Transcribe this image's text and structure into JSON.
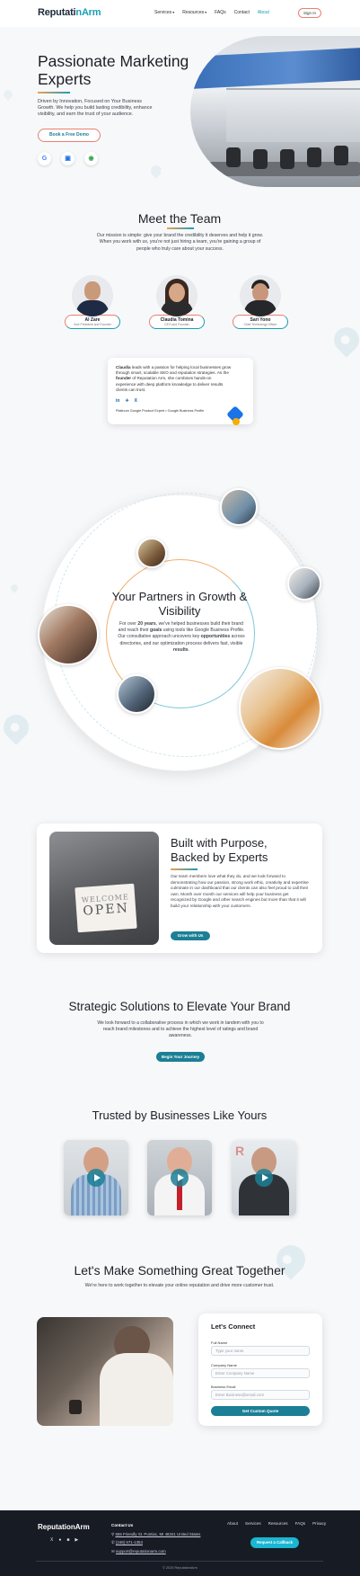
{
  "nav": {
    "logo_a": "Reputati",
    "logo_b": "n",
    "logo_c": "Arm",
    "links": [
      "Services",
      "Resources",
      "FAQs",
      "Contact",
      "About"
    ],
    "signin": "Sign In"
  },
  "hero": {
    "title": "Passionate Marketing Experts",
    "description": "Driven by Innovation, Focused on Your Business Growth. We help you build lasting credibility, enhance visibility, and earn the trust of your audience.",
    "cta": "Book a Free Demo",
    "icons": [
      "google-icon",
      "google-business-icon",
      "google-maps-icon"
    ]
  },
  "team": {
    "title": "Meet the Team",
    "description": "Our mission is simple: give your brand the credibility it deserves and help it grow. When you work with us, you're not just hiring a team, you're gaining a group of people who truly care about your success.",
    "members": [
      {
        "name": "Al Zare",
        "role": "Vice President and Founder"
      },
      {
        "name": "Claudia Tomina",
        "role": "CEO and Founder"
      },
      {
        "name": "Sari Yono",
        "role": "Chief Technology Officer"
      }
    ],
    "bio_prefix": "Claudia",
    "bio_text": " leads with a passion for helping local businesses grow through smart, scalable SEO and reputation strategies. As the ",
    "bio_bold": "founder",
    "bio_text2": " of Reputation Arm, she combines hands-on experience with deep platform knowledge to deliver results clients can trust.",
    "bio_badge": "Platinum Google Product Expert • Google Business Profile",
    "socials": [
      "in",
      "✈",
      "X"
    ]
  },
  "partners": {
    "title": "Your Partners in Growth & Visibility",
    "desc_a": "For over ",
    "desc_b": "20 years",
    "desc_c": ", we've helped businesses build their brand and reach their ",
    "desc_d": "goals",
    "desc_e": " using tools like Google Business Profile. Our consultative approach uncovers key ",
    "desc_f": "opportunities",
    "desc_g": " across directories, and our optimization process delivers fast, visible ",
    "desc_h": "results",
    "desc_i": "."
  },
  "purpose": {
    "title": "Built with Purpose, Backed by Experts",
    "text": "Our team members love what they do, and we look forward to demonstrating how our passion, strong work ethic, creativity and expertise culminate in our dashboard that our clients can also feel proud to call their own. Month over month our services will help your business get recognized by Google and other search engines but more than that it will build your relationship with your customers.",
    "cta": "Grow with Us",
    "sign_top": "WELCOME",
    "sign_bottom": "OPEN"
  },
  "strategic": {
    "title": "Strategic Solutions to Elevate Your Brand",
    "description": "We look forward to a collaborative process in which we work in tandem with you to reach brand milestones and to achieve the highest level of ratings and brand awareness.",
    "cta": "Begin Your Journey"
  },
  "trusted": {
    "title": "Trusted by Businesses Like Yours"
  },
  "contact": {
    "title": "Let's Make Something Great Together",
    "description": "We're here to work together to elevate your online reputation and drive more customer trust.",
    "form_title": "Let's Connect",
    "fields": [
      {
        "label": "Full Name",
        "placeholder": "Type your name"
      },
      {
        "label": "Company Name",
        "placeholder": "Enter Company Name"
      },
      {
        "label": "Business Email",
        "placeholder": "Enter Business@email.com"
      }
    ],
    "submit": "Get Custom Quote"
  },
  "footer": {
    "logo": "ReputationArm",
    "contact_heading": "Contact Us",
    "address": "555 Friendly St. Pontiac, MI 48341 United States",
    "phone": "(248) 671-1353",
    "email": "support@reputationarm.com",
    "links": [
      "About",
      "Services",
      "Resources",
      "FAQs",
      "Privacy"
    ],
    "cta": "Request a Callback",
    "copyright": "© 2025 ReputationArm"
  },
  "colors": {
    "teal": "#1b7f95",
    "accent_cyan": "#1b9db5",
    "accent_coral": "#e88070",
    "footer_bg": "#171b24"
  }
}
